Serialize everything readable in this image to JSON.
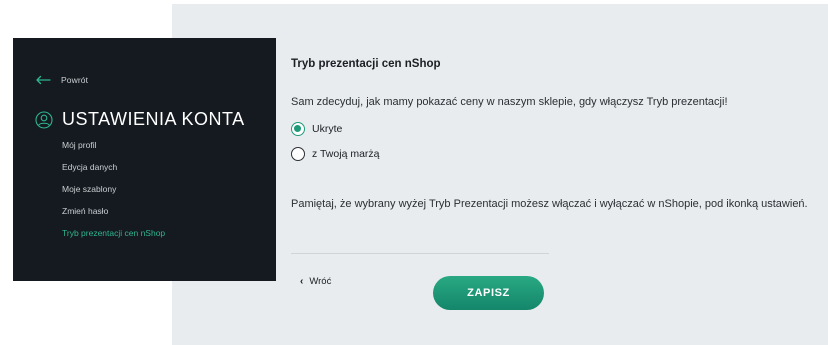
{
  "sidebar": {
    "back_label": "Powrót",
    "title": "USTAWIENIA KONTA",
    "items": [
      {
        "label": "Mój profil",
        "active": false
      },
      {
        "label": "Edycja danych",
        "active": false
      },
      {
        "label": "Moje szablony",
        "active": false
      },
      {
        "label": "Zmień hasło",
        "active": false
      },
      {
        "label": "Tryb prezentacji cen nShop",
        "active": true
      }
    ]
  },
  "main": {
    "section_title": "Tryb prezentacji cen nShop",
    "description": "Sam zdecyduj, jak mamy pokazać ceny w naszym sklepie, gdy włączysz Tryb prezentacji!",
    "options": [
      {
        "label": "Ukryte",
        "selected": true
      },
      {
        "label": "z Twoją marżą",
        "selected": false
      }
    ],
    "note": "Pamiętaj, że wybrany wyżej Tryb Prezentacji możesz włączać i wyłączać w nShopie, pod ikonką ustawień.",
    "back_label": "Wróć",
    "save_label": "ZAPISZ"
  },
  "colors": {
    "accent": "#1f9a78",
    "sidebar_bg": "#141a1f",
    "content_bg": "#e9ecef",
    "active_item": "#2fb58f"
  }
}
